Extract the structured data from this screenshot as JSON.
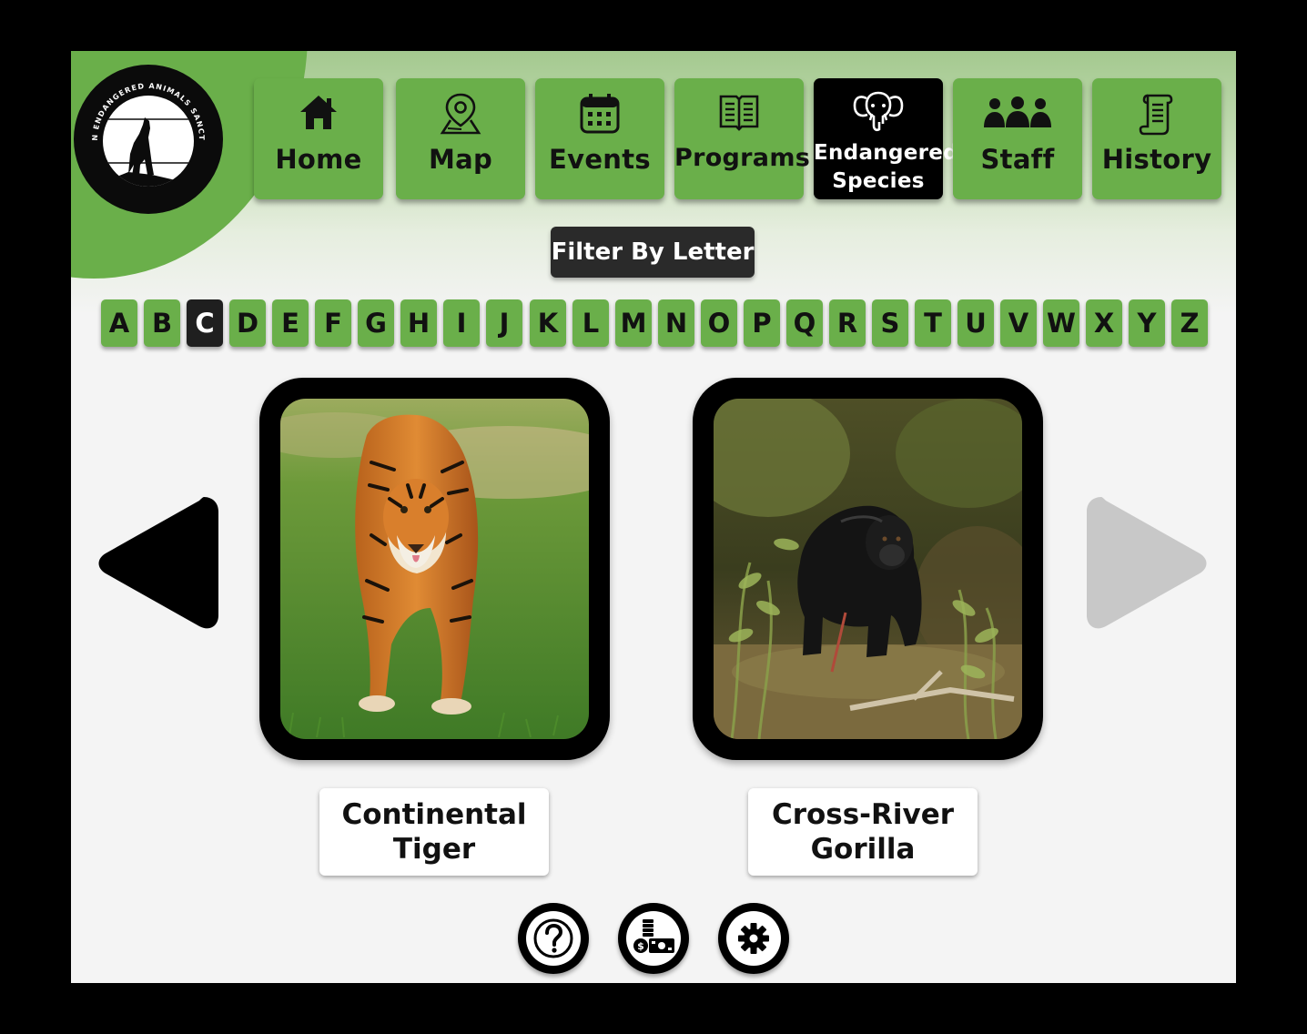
{
  "app": {
    "logo_text": "ASTON ENDANGERED ANIMALS SANCTUARY"
  },
  "nav": {
    "home": "Home",
    "map": "Map",
    "events": "Events",
    "programs": "Programs",
    "endangered_line1": "Endangered",
    "endangered_line2": "Species",
    "staff": "Staff",
    "history": "History",
    "active": "Endangered Species"
  },
  "filter": {
    "label": "Filter By Letter",
    "letters": [
      "A",
      "B",
      "C",
      "D",
      "E",
      "F",
      "G",
      "H",
      "I",
      "J",
      "K",
      "L",
      "M",
      "N",
      "O",
      "P",
      "Q",
      "R",
      "S",
      "T",
      "U",
      "V",
      "W",
      "X",
      "Y",
      "Z"
    ],
    "selected": "C"
  },
  "carousel": {
    "prev_enabled": true,
    "next_enabled": false,
    "cards": [
      {
        "line1": "Continental",
        "line2": "Tiger",
        "image": "tiger-photo"
      },
      {
        "line1": "Cross-River",
        "line2": "Gorilla",
        "image": "gorilla-photo"
      }
    ]
  },
  "footer": {
    "buttons": [
      "help-icon",
      "donate-money-icon",
      "settings-gear-icon"
    ]
  },
  "colors": {
    "accent_green": "#6aaf4a",
    "active_black": "#000000",
    "disabled_gray": "#c8c8c8",
    "background": "#f4f4f4"
  }
}
